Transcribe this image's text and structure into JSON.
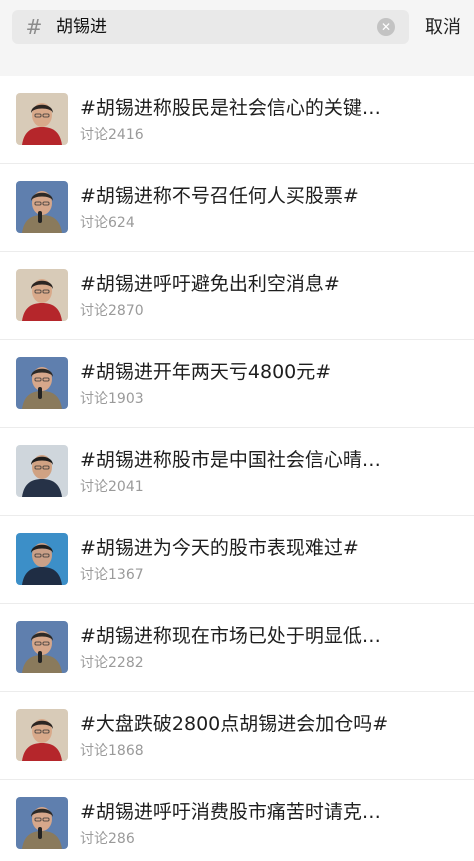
{
  "search": {
    "icon": "hash-icon",
    "value": "胡锡进",
    "clear_icon": "clear-icon",
    "cancel_label": "取消"
  },
  "results": [
    {
      "title": "#胡锡进称股民是社会信心的关键…",
      "count": "讨论2416",
      "avatar": "red-shirt"
    },
    {
      "title": "#胡锡进称不号召任何人买股票#",
      "count": "讨论624",
      "avatar": "mic-blue"
    },
    {
      "title": "#胡锡进呼吁避免出利空消息#",
      "count": "讨论2870",
      "avatar": "red-shirt"
    },
    {
      "title": "#胡锡进开年两天亏4800元#",
      "count": "讨论1903",
      "avatar": "mic-blue"
    },
    {
      "title": "#胡锡进称股市是中国社会信心晴…",
      "count": "讨论2041",
      "avatar": "suit-dark"
    },
    {
      "title": "#胡锡进为今天的股市表现难过#",
      "count": "讨论1367",
      "avatar": "stage-blue"
    },
    {
      "title": "#胡锡进称现在市场已处于明显低…",
      "count": "讨论2282",
      "avatar": "mic-blue"
    },
    {
      "title": "#大盘跌破2800点胡锡进会加仓吗#",
      "count": "讨论1868",
      "avatar": "red-shirt"
    },
    {
      "title": "#胡锡进呼吁消费股市痛苦时请克…",
      "count": "讨论286",
      "avatar": "mic-blue"
    }
  ],
  "colors": {
    "header_bg": "#f5f5f5",
    "search_bg": "#e9e9e9",
    "muted_text": "#9a9a9a"
  }
}
